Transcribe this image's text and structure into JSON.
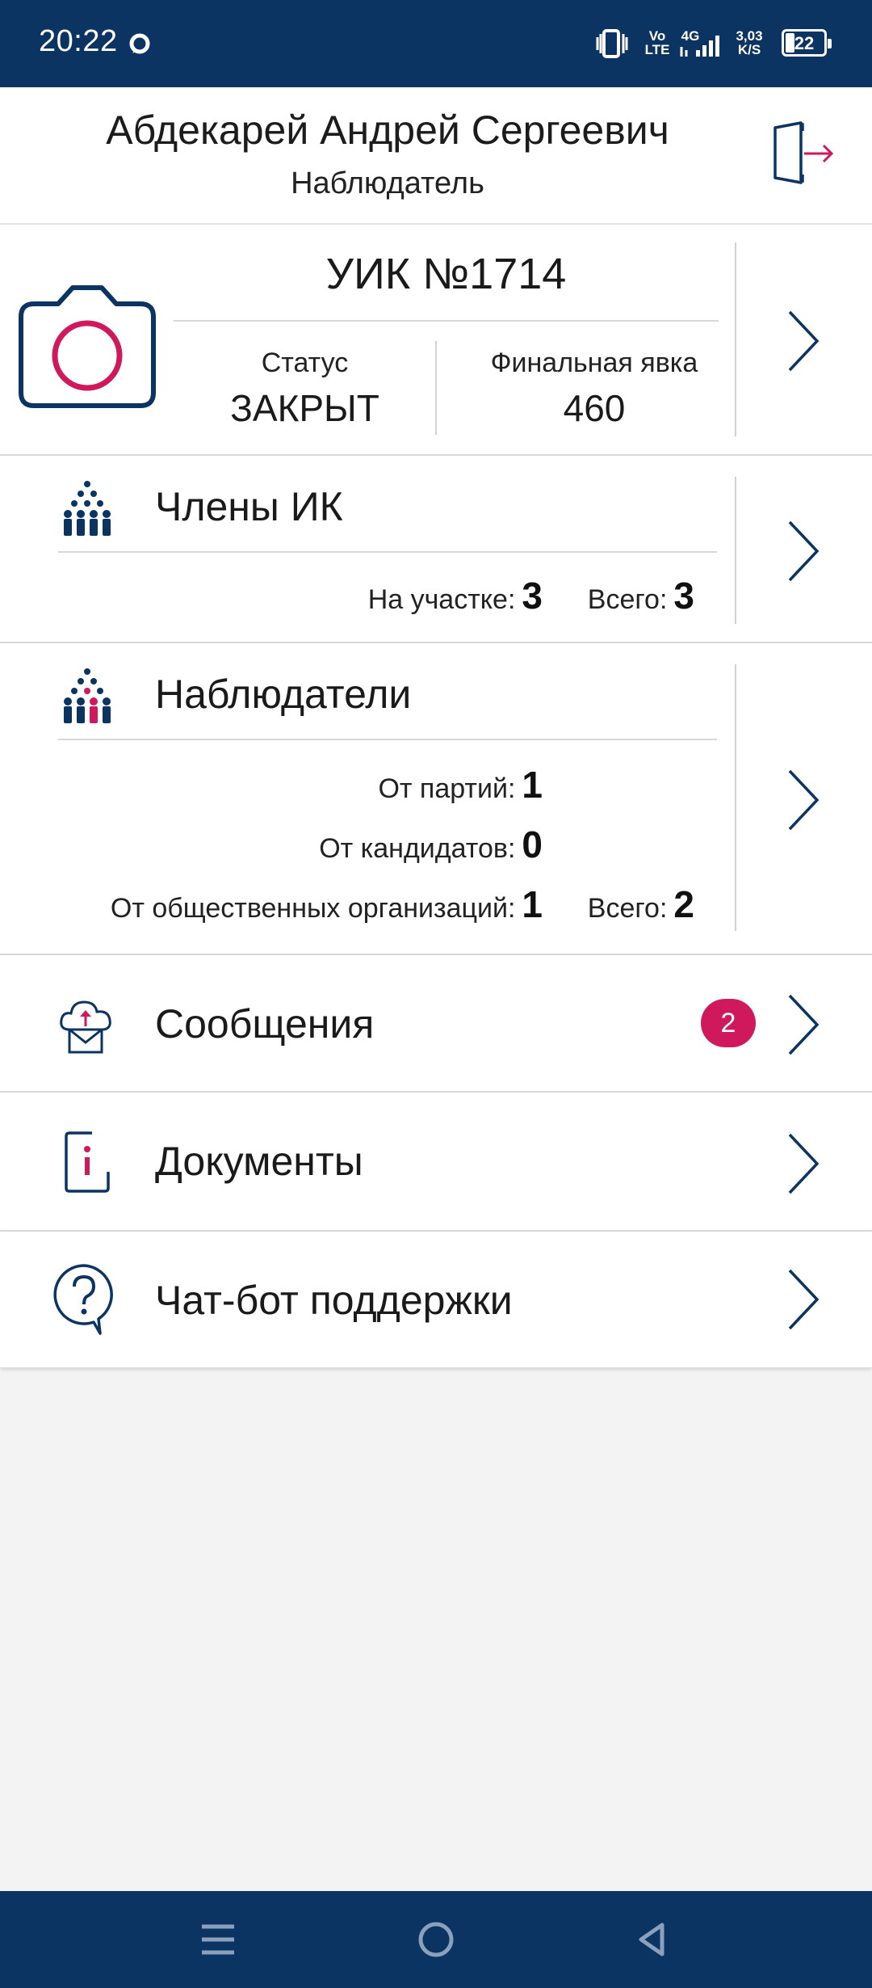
{
  "status_bar": {
    "time": "20:22",
    "volte": [
      "Vo",
      "LTE"
    ],
    "network": "4G",
    "speed": [
      "3,03",
      "K/S"
    ],
    "battery": "22",
    "colors": {
      "background": "#0c3463"
    }
  },
  "header": {
    "name": "Абдекарей Андрей Сергеевич",
    "role": "Наблюдатель",
    "logout_icon": "logout-door-icon"
  },
  "uik": {
    "title": "УИК №1714",
    "status_label": "Статус",
    "status_value": "ЗАКРЫТ",
    "turnout_label": "Финальная явка",
    "turnout_value": "460",
    "icon": "camera-icon"
  },
  "members": {
    "title": "Члены ИК",
    "on_site_label": "На участке:",
    "on_site_value": "3",
    "total_label": "Всего:",
    "total_value": "3",
    "icon": "people-group-icon"
  },
  "observers": {
    "title": "Наблюдатели",
    "parties_label": "От партий:",
    "parties_value": "1",
    "candidates_label": "От кандидатов:",
    "candidates_value": "0",
    "orgs_label": "От общественных организаций:",
    "orgs_value": "1",
    "total_label": "Всего:",
    "total_value": "2",
    "icon": "people-group-highlight-icon"
  },
  "messages": {
    "title": "Сообщения",
    "badge": "2",
    "icon": "cloud-mail-icon"
  },
  "documents": {
    "title": "Документы",
    "icon": "document-info-icon"
  },
  "chatbot": {
    "title": "Чат-бот поддержки",
    "icon": "question-bubble-icon"
  },
  "colors": {
    "primary": "#0c3463",
    "accent": "#d0185c",
    "background": "#f3f3f4"
  }
}
